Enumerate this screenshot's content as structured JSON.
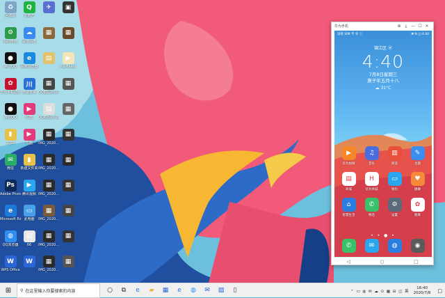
{
  "desktop": {
    "icons": [
      {
        "label": "回收站",
        "color": "#7da6c7",
        "glyph": "♻"
      },
      {
        "label": "爱奇艺",
        "color": "#1fb33f",
        "glyph": "Q"
      },
      {
        "label": "",
        "color": "#5a6fd0",
        "glyph": "✈"
      },
      {
        "label": "",
        "color": "#333333",
        "glyph": "▣"
      },
      {
        "label": "我的电脑",
        "color": "#2e9b4c",
        "glyph": "⚙"
      },
      {
        "label": "百度网盘",
        "color": "#3a8bf0",
        "glyph": "☁"
      },
      {
        "label": "",
        "color": "#8a6a3a",
        "glyph": "▦"
      },
      {
        "label": "",
        "color": "#6a4a2a",
        "glyph": "▦"
      },
      {
        "label": "腾讯QQ",
        "color": "#111111",
        "glyph": "●"
      },
      {
        "label": "百度浏览器",
        "color": "#1a8ae0",
        "glyph": "e"
      },
      {
        "label": "",
        "color": "#e2c26a",
        "glyph": "▤"
      },
      {
        "label": "PotPlayer",
        "color": "#f2e6b8",
        "glyph": "▶"
      },
      {
        "label": "华为手机助手",
        "color": "#c8102e",
        "glyph": "✿"
      },
      {
        "label": "电脑管家",
        "color": "#2a6fd6",
        "glyph": "川"
      },
      {
        "label": "QQ截图20200...",
        "color": "#444444",
        "glyph": "▦"
      },
      {
        "label": "",
        "color": "#555555",
        "glyph": "▦"
      },
      {
        "label": "腾讯QQ",
        "color": "#111111",
        "glyph": "●"
      },
      {
        "label": "优酷",
        "color": "#e23a7a",
        "glyph": "▶"
      },
      {
        "label": "QQ截图20200...",
        "color": "#dddddd",
        "glyph": "▤"
      },
      {
        "label": "",
        "color": "#666666",
        "glyph": "▦"
      },
      {
        "label": "2020",
        "color": "#e8c14a",
        "glyph": "▮"
      },
      {
        "label": "优酷",
        "color": "#e23a7a",
        "glyph": "▶"
      },
      {
        "label": "IMG_2020...",
        "color": "#2a2a2a",
        "glyph": "▦"
      },
      {
        "label": "",
        "color": "#333333",
        "glyph": "▦"
      },
      {
        "label": "微信",
        "color": "#2aae67",
        "glyph": "✉"
      },
      {
        "label": "新建文件夹",
        "color": "#e8c14a",
        "glyph": "▮"
      },
      {
        "label": "IMG_2020...",
        "color": "#2a2a2a",
        "glyph": "▦"
      },
      {
        "label": "",
        "color": "#2a2a2a",
        "glyph": "▦"
      },
      {
        "label": "Adobe Photosho...",
        "color": "#0a2a5a",
        "glyph": "Ps"
      },
      {
        "label": "腾讯视频",
        "color": "#2aa6ef",
        "glyph": "▶"
      },
      {
        "label": "IMG_2020...",
        "color": "#2a2a2a",
        "glyph": "▦"
      },
      {
        "label": "",
        "color": "#333333",
        "glyph": "▦"
      },
      {
        "label": "Microsoft Edge",
        "color": "#1e78d6",
        "glyph": "e"
      },
      {
        "label": "此电脑",
        "color": "#4aa0e6",
        "glyph": "▭"
      },
      {
        "label": "IMG_2020...",
        "color": "#7a5a3a",
        "glyph": "▦"
      },
      {
        "label": "",
        "color": "#444444",
        "glyph": "▦"
      },
      {
        "label": "QQ浏览器",
        "color": "#2f8ef0",
        "glyph": "◍"
      },
      {
        "label": "66",
        "color": "#e8e8e8",
        "glyph": "▤"
      },
      {
        "label": "IMG_2020...",
        "color": "#2a2a2a",
        "glyph": "▦"
      },
      {
        "label": "",
        "color": "#333333",
        "glyph": "▦"
      },
      {
        "label": "WPS Office",
        "color": "#2a66d6",
        "glyph": "W"
      },
      {
        "label": "",
        "color": "#2a66d6",
        "glyph": "W"
      },
      {
        "label": "IMG_2020...",
        "color": "#2a2a2a",
        "glyph": "▦"
      },
      {
        "label": "",
        "color": "#555555",
        "glyph": "▦"
      }
    ]
  },
  "phone_window": {
    "title": "华为手机",
    "controls": [
      "⊕",
      "⤓",
      "—",
      "☐",
      "✕"
    ],
    "status_left": "没有 SIM 卡 令 ⓘ",
    "status_right": "✱ N ◫ 4:40",
    "location": "锦江区 ⦿",
    "time": "4:40",
    "date": "7月8日星期三",
    "lunar": "庚子年五月十八",
    "weather": "☁ 31°C",
    "apps": [
      {
        "label": "华为视频",
        "color": "#f5862a",
        "glyph": "▶"
      },
      {
        "label": "音乐",
        "color": "#4a6ee0",
        "glyph": "♫"
      },
      {
        "label": "阅读",
        "color": "#e8503a",
        "glyph": "▥"
      },
      {
        "label": "主题",
        "color": "#3a8ef0",
        "glyph": "✎"
      },
      {
        "label": "商城",
        "color": "#ffffff",
        "glyph": "▤"
      },
      {
        "label": "华为商城",
        "color": "#ffffff",
        "glyph": "H"
      },
      {
        "label": "钱包",
        "color": "#2aa6ef",
        "glyph": "▭"
      },
      {
        "label": "健康",
        "color": "#f58a3a",
        "glyph": "♥"
      },
      {
        "label": "智慧生活",
        "color": "#2a7ee0",
        "glyph": "⌂"
      },
      {
        "label": "畅连",
        "color": "#3ac26a",
        "glyph": "✆"
      },
      {
        "label": "设置",
        "color": "#5a6a7a",
        "glyph": "⚙"
      },
      {
        "label": "图库",
        "color": "#ffffff",
        "glyph": "✿"
      }
    ],
    "dots": "• • ● •",
    "dock": [
      {
        "label": "",
        "color": "#3ac26a",
        "glyph": "✆"
      },
      {
        "label": "",
        "color": "#2aa6ef",
        "glyph": "✉"
      },
      {
        "label": "",
        "color": "#2a7ee0",
        "glyph": "◍"
      },
      {
        "label": "",
        "color": "#5a5a5a",
        "glyph": "◉"
      }
    ],
    "nav": [
      "◁",
      "○",
      "□"
    ]
  },
  "taskbar": {
    "start_glyph": "⊞",
    "search_placeholder": "在这里输入你要搜索的内容",
    "pinned": [
      {
        "name": "cortana-icon",
        "glyph": "○",
        "color": "#222"
      },
      {
        "name": "task-view-icon",
        "glyph": "⧉",
        "color": "#222"
      },
      {
        "name": "edge-icon",
        "glyph": "e",
        "color": "#1e78d6"
      },
      {
        "name": "file-explorer-icon",
        "glyph": "▰",
        "color": "#e8b43a"
      },
      {
        "name": "store-icon",
        "glyph": "▦",
        "color": "#2a66d6"
      },
      {
        "name": "edge-icon-2",
        "glyph": "e",
        "color": "#1e78d6"
      },
      {
        "name": "qq-browser-icon",
        "glyph": "◍",
        "color": "#2f8ef0"
      },
      {
        "name": "mail-icon",
        "glyph": "✉",
        "color": "#2a66d6"
      },
      {
        "name": "photos-icon",
        "glyph": "▨",
        "color": "#2a66d6"
      },
      {
        "name": "phone-icon",
        "glyph": "▯",
        "color": "#333"
      }
    ],
    "tray": "⌃ ▭ ◍ ✉ ☁ ⊙ ▦ ⊟ ◫ 英",
    "clock_time": "16:40",
    "clock_date": "2020/7/8"
  }
}
